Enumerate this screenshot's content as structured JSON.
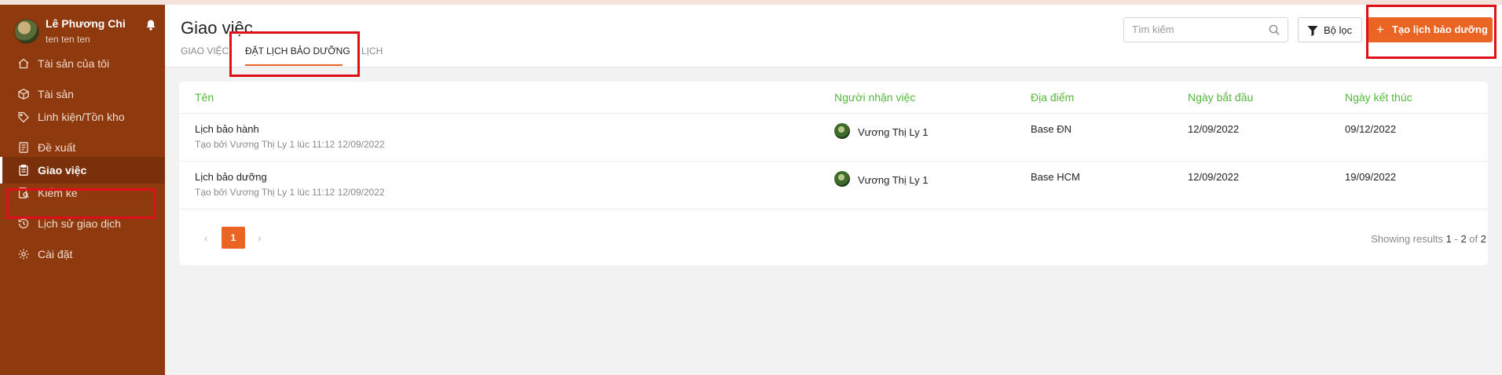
{
  "user": {
    "name": "Lê Phương Chi",
    "subtitle": "ten ten ten"
  },
  "sidebar": {
    "items": [
      {
        "label": "Tài sản của tôi",
        "icon": "home-icon"
      },
      {
        "label": "Tài sản",
        "icon": "box-icon"
      },
      {
        "label": "Linh kiện/Tồn kho",
        "icon": "tag-icon"
      },
      {
        "label": "Đề xuất",
        "icon": "document-icon"
      },
      {
        "label": "Giao việc",
        "icon": "clipboard-icon",
        "active": true
      },
      {
        "label": "Kiểm kê",
        "icon": "inventory-icon"
      },
      {
        "label": "Lịch sử giao dịch",
        "icon": "history-icon"
      },
      {
        "label": "Cài đặt",
        "icon": "gear-icon"
      }
    ]
  },
  "header": {
    "title": "Giao việc",
    "tabs": [
      {
        "label": "GIAO VIỆC"
      },
      {
        "label": "ĐẶT LỊCH BẢO DƯỠNG",
        "active": true
      },
      {
        "label": "LỊCH"
      }
    ],
    "search_placeholder": "Tìm kiếm",
    "filter_label": "Bộ lọc",
    "create_label": "Tạo lịch bảo dưỡng"
  },
  "table": {
    "columns": [
      "Tên",
      "Người nhận việc",
      "Địa điểm",
      "Ngày bắt đầu",
      "Ngày kết thúc"
    ],
    "rows": [
      {
        "name": "Lịch bảo hành",
        "created": "Tạo bởi Vương Thị Ly 1 lúc 11:12 12/09/2022",
        "assignee": "Vương Thị Ly 1",
        "location": "Base ĐN",
        "start": "12/09/2022",
        "end": "09/12/2022"
      },
      {
        "name": "Lịch bảo dưỡng",
        "created": "Tạo bởi Vương Thị Ly 1 lúc 11:12 12/09/2022",
        "assignee": "Vương Thị Ly 1",
        "location": "Base HCM",
        "start": "12/09/2022",
        "end": "19/09/2022"
      }
    ]
  },
  "pagination": {
    "current_page": "1",
    "prefix": "Showing results",
    "from": "1",
    "dash": "-",
    "to": "2",
    "of_label": "of",
    "total": "2"
  },
  "colors": {
    "sidebar": "#8f3a0e",
    "accent": "#ea6424",
    "column_header": "#54b83a",
    "highlight": "#e0101b"
  }
}
